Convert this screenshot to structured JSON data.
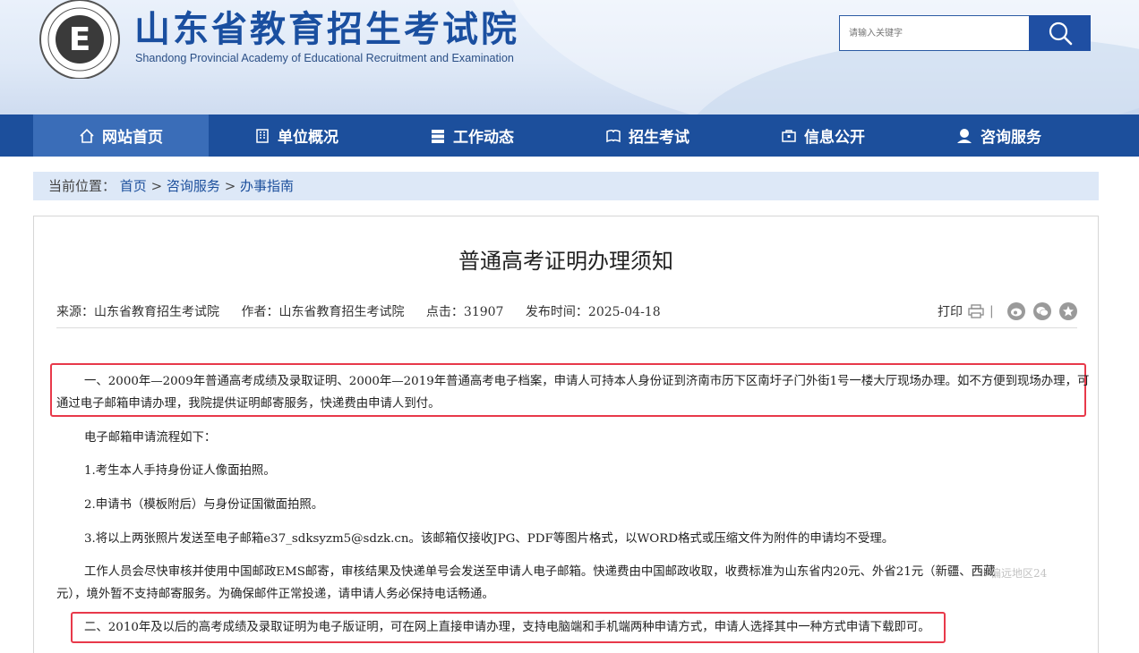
{
  "header": {
    "title": "山东省教育招生考试院",
    "subtitle": "Shandong Provincial Academy of Educational Recruitment and Examination",
    "logo_letter": "E",
    "logo_ring_text": "Shandong Educational Admission & Examination",
    "search_placeholder": "请输入关键字"
  },
  "nav": {
    "items": [
      {
        "label": "网站首页",
        "icon": "home-icon"
      },
      {
        "label": "单位概况",
        "icon": "building-icon"
      },
      {
        "label": "工作动态",
        "icon": "server-icon"
      },
      {
        "label": "招生考试",
        "icon": "book-icon"
      },
      {
        "label": "信息公开",
        "icon": "briefcase-icon"
      },
      {
        "label": "咨询服务",
        "icon": "user-support-icon"
      }
    ]
  },
  "breadcrumb": {
    "prefix": "当前位置：",
    "home": "首页",
    "sep1": " > ",
    "level2": "咨询服务",
    "sep2": " > ",
    "level3": "办事指南"
  },
  "article": {
    "title": "普通高考证明办理须知",
    "source": "来源：山东省教育招生考试院",
    "author": "作者：山东省教育招生考试院",
    "clicks": "点击：31907",
    "date": "发布时间：2025-04-18",
    "print_label": "打印",
    "share_sep": "|",
    "p1_line1": "一、2000年—2009年普通高考成绩及录取证明、2000年—2019年普通高考电子档案，申请人可持本人身份证到济南市历下区南圩子门外街1号一楼大厅现场办理。如不方便到现场办理，可",
    "p1_line2": "通过电子邮箱申请办理，我院提供证明邮寄服务，快递费由申请人到付。",
    "p2": "电子邮箱申请流程如下：",
    "p3": "1.考生本人手持身份证人像面拍照。",
    "p4": "2.申请书（模板附后）与身份证国徽面拍照。",
    "p5": "3.将以上两张照片发送至电子邮箱e37_sdksyzm5@sdzk.cn。该邮箱仅接收JPG、PDF等图片格式，以WORD格式或压缩文件为附件的申请均不受理。",
    "p6_line1": "工作人员会尽快审核并使用中国邮政EMS邮寄，审核结果及快递单号会发送至申请人电子邮箱。快递费由中国邮政收取，收费标准为山东省内20元、外省21元（新疆、西藏",
    "p6_line2": "元），境外暂不支持邮寄服务。为确保邮件正常投递，请申请人务必保持电话畅通。",
    "p7": "二、2010年及以后的高考成绩及录取证明为电子版证明，可在网上直接申请办理，支持电脑端和手机端两种申请方式，申请人选择其中一种方式申请下载即可。",
    "watermark": "偏远地区24"
  },
  "colors": {
    "brand": "#1c4f9c",
    "nav_active": "#3a6db8",
    "highlight_box": "#e8394a"
  }
}
